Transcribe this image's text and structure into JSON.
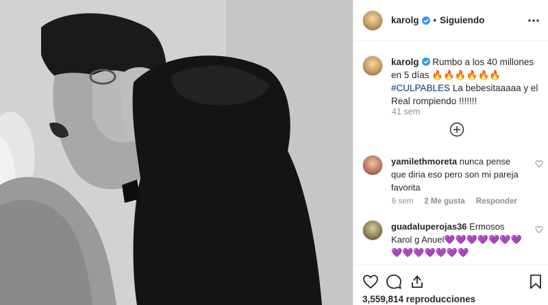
{
  "header": {
    "username": "karolg",
    "separator": "•",
    "follow_label": "Siguiendo"
  },
  "caption": {
    "username": "karolg",
    "text": "Rumbo a los 40 millones en 5 días 🔥🔥🔥🔥🔥🔥",
    "hashtag": "#CULPABLES",
    "text2": "La bebesitaaaaa y el Real rompiendo !!!!!!!",
    "time": "41 sem"
  },
  "comments": [
    {
      "username": "yamilethmoreta",
      "text": "nunca pense que diria eso pero son mi pareja favorita",
      "time": "6 sem",
      "likes": "2 Me gusta",
      "reply": "Responder"
    },
    {
      "username": "guadaluperojas36",
      "text": "Ermosos Karol g Anuel💜💜💜💜💜💜💜💜💜💜💜💜💜💜",
      "time": "",
      "likes": "",
      "reply": ""
    }
  ],
  "stats": {
    "views": "3,559,814 reproducciones"
  },
  "icons": [
    "more-icon",
    "verified-icon",
    "add-comment-icon",
    "heart-icon",
    "comment-icon",
    "share-icon",
    "bookmark-icon"
  ],
  "colors": {
    "text": "#262626",
    "secondary": "#8e8e8e",
    "verified": "#3897f0",
    "hashtag": "#00376b",
    "border": "#efefef"
  }
}
